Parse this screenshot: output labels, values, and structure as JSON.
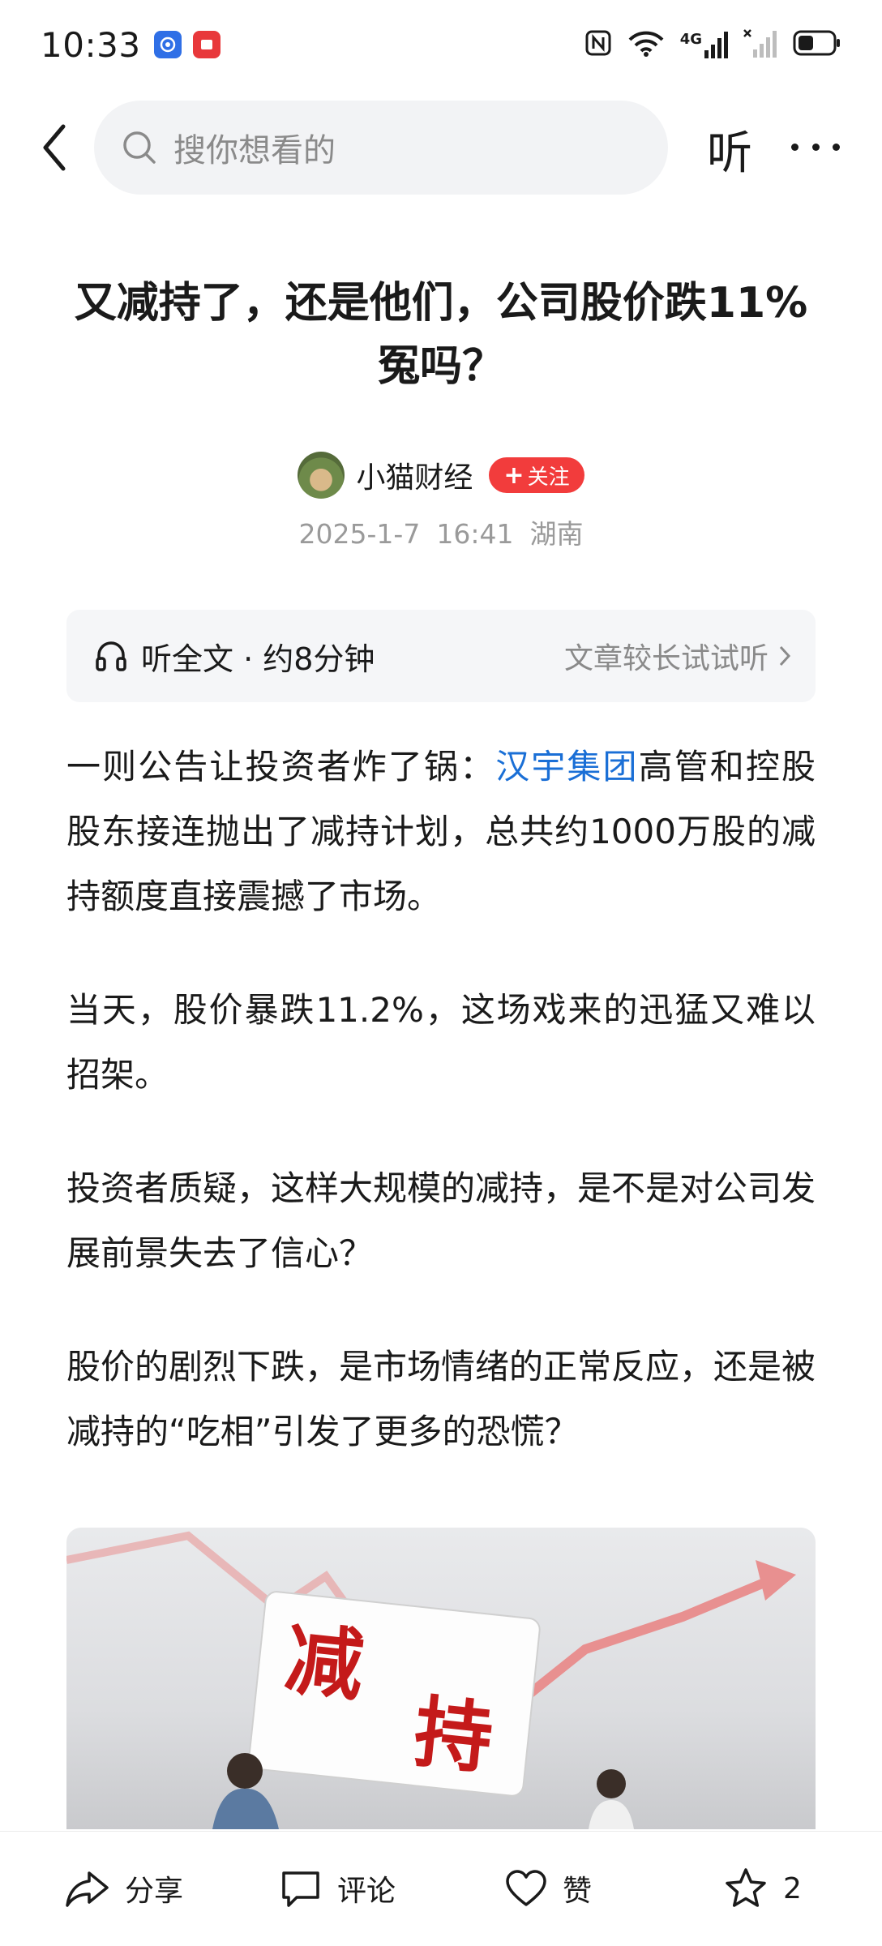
{
  "status_bar": {
    "time": "10:33",
    "network": "4G",
    "icons": [
      "nfc-icon",
      "wifi-icon",
      "signal-4g-icon",
      "signal-no-sim-icon",
      "battery-icon"
    ]
  },
  "nav": {
    "search_placeholder": "搜你想看的",
    "listen_label": "听"
  },
  "article": {
    "title": "又减持了，还是他们，公司股价跌11%冤吗？",
    "author": "小猫财经",
    "follow_label": "关注",
    "date": "2025-1-7",
    "time": "16:41",
    "location": "湖南",
    "listen_bar": {
      "label": "听全文 · 约8分钟",
      "hint": "文章较长试试听"
    },
    "para1_before": "一则公告让投资者炸了锅：",
    "para1_link": "汉宇集团",
    "para1_after": "高管和控股股东接连抛出了减持计划，总共约1000万股的减持额度直接震撼了市场。",
    "para2": "当天，股价暴跌11.2%，这场戏来的迅猛又难以招架。",
    "para3": "投资者质疑，这样大规模的减持，是不是对公司发展前景失去了信心？",
    "para4": "股价的剧烈下跌，是市场情绪的正常反应，还是被减持的“吃相”引发了更多的恐慌？",
    "image_text": [
      "减",
      "持"
    ]
  },
  "bottom_bar": {
    "share_label": "分享",
    "comment_label": "评论",
    "like_label": "赞",
    "favorite_count": "2"
  },
  "colors": {
    "link": "#1a6fd6",
    "follow": "#f23c3c",
    "image_text": "#c41a1a"
  }
}
